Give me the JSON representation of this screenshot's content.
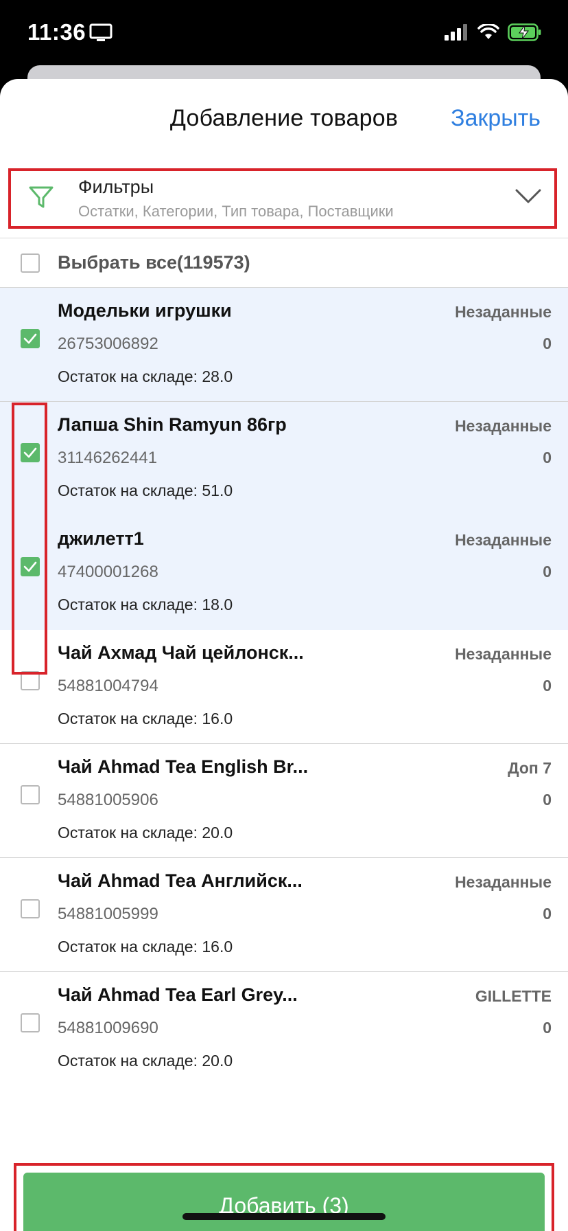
{
  "status": {
    "time": "11:36"
  },
  "header": {
    "title": "Добавление товаров",
    "close_label": "Закрыть"
  },
  "filters": {
    "title": "Фильтры",
    "subtitle": "Остатки, Категории, Тип товара, Поставщики"
  },
  "select_all": {
    "label": "Выбрать все(119573)"
  },
  "items": [
    {
      "name": "Модельки игрушки",
      "code": "26753006892",
      "stock": "Остаток на складе: 28.0",
      "tag": "Незаданные",
      "qty": "0",
      "checked": true
    },
    {
      "name": "Лапша Shin Ramyun 86гр",
      "code": "31146262441",
      "stock": "Остаток на складе: 51.0",
      "tag": "Незаданные",
      "qty": "0",
      "checked": true
    },
    {
      "name": "джилетт1",
      "code": "47400001268",
      "stock": "Остаток на складе: 18.0",
      "tag": "Незаданные",
      "qty": "0",
      "checked": true
    },
    {
      "name": "Чай Ахмад Чай цейлонск...",
      "code": "54881004794",
      "stock": "Остаток на складе: 16.0",
      "tag": "Незаданные",
      "qty": "0",
      "checked": false
    },
    {
      "name": "Чай Ahmad Tea English Br...",
      "code": "54881005906",
      "stock": "Остаток на складе: 20.0",
      "tag": "Доп 7",
      "qty": "0",
      "checked": false
    },
    {
      "name": "Чай Ahmad Tea Английск...",
      "code": "54881005999",
      "stock": "Остаток на складе: 16.0",
      "tag": "Незаданные",
      "qty": "0",
      "checked": false
    },
    {
      "name": "Чай Ahmad Tea Earl Grey...",
      "code": "54881009690",
      "stock": "Остаток на складе: 20.0",
      "tag": "GILLETTE",
      "qty": "0",
      "checked": false
    }
  ],
  "add_button": {
    "label": "Добавить (3)"
  },
  "colors": {
    "accent_green": "#5cb96b",
    "link_blue": "#2f7fe0",
    "highlight_red": "#d8232a",
    "selected_row_bg": "#edf3fd"
  }
}
